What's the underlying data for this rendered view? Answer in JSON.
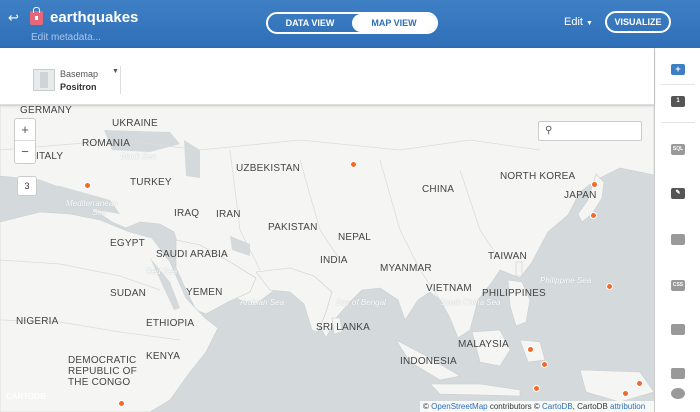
{
  "header": {
    "back_icon": "back-arrow-icon",
    "lock_icon": "lock-icon",
    "title": "earthquakes",
    "edit_metadata": "Edit metadata...",
    "data_view": "DATA VIEW",
    "map_view": "MAP VIEW",
    "edit": "Edit",
    "visualize": "VISUALIZE"
  },
  "basemap": {
    "label": "Basemap",
    "value": "Positron"
  },
  "map": {
    "zoom_in": "+",
    "zoom_out": "−",
    "zoom_level": "3",
    "search_icon": "search-icon",
    "logo": "CARTODB",
    "countries": [
      "GERMANY",
      "UKRAINE",
      "ROMANIA",
      "ITALY",
      "TURKEY",
      "IRAQ",
      "IRAN",
      "UZBEKISTAN",
      "CHINA",
      "NORTH KOREA",
      "JAPAN",
      "PAKISTAN",
      "NEPAL",
      "INDIA",
      "EGYPT",
      "SAUDI ARABIA",
      "MYANMAR",
      "TAIWAN",
      "SUDAN",
      "YEMEN",
      "VIETNAM",
      "PHILIPPINES",
      "ETHIOPIA",
      "SRI LANKA",
      "NIGERIA",
      "KENYA",
      "MALAYSIA",
      "INDONESIA",
      "DEMOCRATIC",
      "REPUBLIC OF",
      "THE CONGO"
    ],
    "seas": [
      "Black Sea",
      "Mediterranean",
      "Sea",
      "Red Sea",
      "Arabian Sea",
      "Bay of Bengal",
      "South China Sea",
      "Philippine Sea"
    ]
  },
  "attribution": {
    "prefix": "©",
    "osm": "OpenStreetMap",
    "contributors": " contributors © ",
    "cartodb": "CartoDB",
    "sep": ", CartoDB ",
    "attribution": "attribution"
  },
  "right_panel": {
    "icons": [
      "add-layer-icon",
      "layer-1-icon",
      "sql-icon",
      "wizard-icon",
      "infowindow-icon",
      "css-icon",
      "legend-icon",
      "filter-icon",
      "map-pin-icon"
    ],
    "layer_number": "1",
    "sql_label": "SQL",
    "css_label": "CSS"
  },
  "colors": {
    "header": "#2f6fb8",
    "point": "#f26a2b",
    "land": "#f5f5f3",
    "water": "#d4dadc"
  }
}
